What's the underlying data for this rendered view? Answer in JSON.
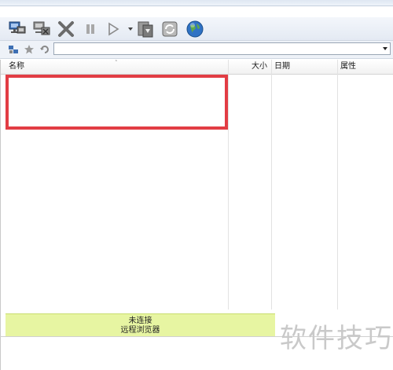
{
  "toolbar": {
    "buttons": [
      {
        "icon": "connect-icon"
      },
      {
        "icon": "disconnect-icon"
      },
      {
        "icon": "delete-icon"
      },
      {
        "icon": "pause-icon"
      },
      {
        "icon": "play-icon"
      },
      {
        "icon": "transfer-icon"
      },
      {
        "icon": "refresh-icon"
      },
      {
        "icon": "globe-icon"
      }
    ]
  },
  "address": {
    "value": "",
    "icons": [
      "site-manager-icon",
      "favorites-star-icon",
      "back-arrow-icon"
    ]
  },
  "file_list": {
    "columns": {
      "name": "名称",
      "size": "大小",
      "date": "日期",
      "attributes": "属性"
    },
    "rows": []
  },
  "status": {
    "line1": "未连接",
    "line2": "远程浏览器"
  },
  "watermark": "软件技巧",
  "colors": {
    "status_bg": "#e7f5a2",
    "highlight_border": "#e23d44",
    "toolbar_bg": "#e9eef6"
  }
}
